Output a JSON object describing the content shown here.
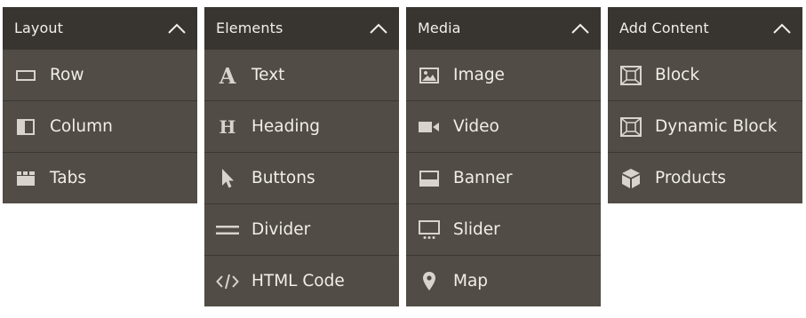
{
  "colors": {
    "panel_bg": "#514c45",
    "header_bg": "#383430",
    "divider": "#3b3733",
    "text": "#f1eee9",
    "icon": "#d8d3cc"
  },
  "panels": [
    {
      "title": "Layout",
      "expanded": true,
      "items": [
        {
          "label": "Row",
          "icon": "row-icon"
        },
        {
          "label": "Column",
          "icon": "column-icon"
        },
        {
          "label": "Tabs",
          "icon": "tabs-icon"
        }
      ]
    },
    {
      "title": "Elements",
      "expanded": true,
      "items": [
        {
          "label": "Text",
          "icon": "text-icon"
        },
        {
          "label": "Heading",
          "icon": "heading-icon"
        },
        {
          "label": "Buttons",
          "icon": "buttons-cursor-icon"
        },
        {
          "label": "Divider",
          "icon": "divider-icon"
        },
        {
          "label": "HTML Code",
          "icon": "html-code-icon"
        }
      ]
    },
    {
      "title": "Media",
      "expanded": true,
      "items": [
        {
          "label": "Image",
          "icon": "image-icon"
        },
        {
          "label": "Video",
          "icon": "video-icon"
        },
        {
          "label": "Banner",
          "icon": "banner-icon"
        },
        {
          "label": "Slider",
          "icon": "slider-icon"
        },
        {
          "label": "Map",
          "icon": "map-pin-icon"
        }
      ]
    },
    {
      "title": "Add Content",
      "expanded": true,
      "items": [
        {
          "label": "Block",
          "icon": "block-icon"
        },
        {
          "label": "Dynamic Block",
          "icon": "dynamic-block-icon"
        },
        {
          "label": "Products",
          "icon": "products-icon"
        }
      ]
    }
  ]
}
